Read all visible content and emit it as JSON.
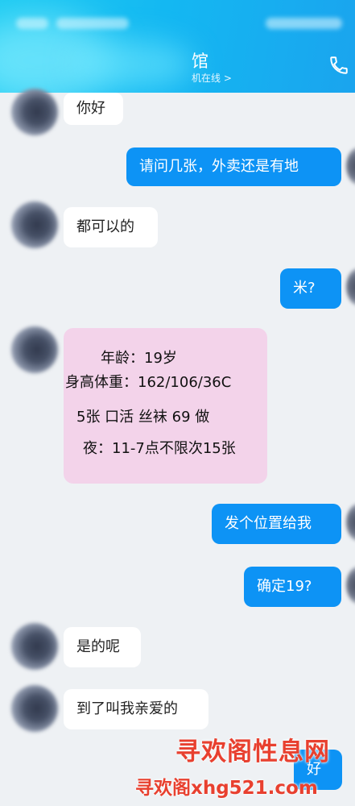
{
  "header": {
    "title": "馆",
    "subtitle": "机在线 >",
    "phone_icon": "phone-icon",
    "bg_color": "#14b8f2"
  },
  "messages": [
    {
      "side": "left",
      "text": "你好"
    },
    {
      "side": "right",
      "text": "请问几张，外卖还是有地"
    },
    {
      "side": "left",
      "text": "都可以的"
    },
    {
      "side": "right",
      "text": "米?"
    },
    {
      "side": "left",
      "type": "card",
      "lines": [
        "年龄：19岁",
        "身高体重：162/106/36C",
        "5张 口活 丝袜 69 做",
        "夜：11-7点不限次15张"
      ]
    },
    {
      "side": "right",
      "text": "发个位置给我"
    },
    {
      "side": "right",
      "text": "确定19?"
    },
    {
      "side": "left",
      "text": "是的呢"
    },
    {
      "side": "left",
      "text": "到了叫我亲爱的"
    },
    {
      "side": "right",
      "text": "好"
    }
  ],
  "watermark": {
    "line1": "寻欢阁性息网",
    "line2": "寻欢阁xhg521.com",
    "color": "#e8402f"
  },
  "colors": {
    "sent_bubble": "#0d93f5",
    "received_bubble": "#ffffff",
    "card_bubble": "#f3d3ea",
    "chat_bg": "#eef1f4"
  }
}
